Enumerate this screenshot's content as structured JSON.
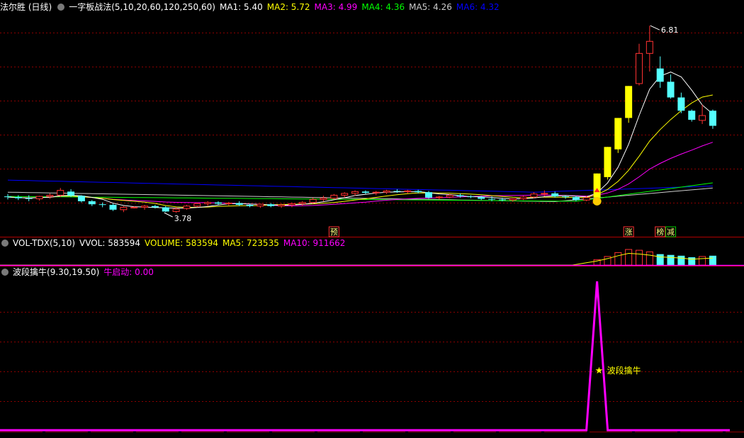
{
  "main": {
    "title": "法尔胜 (日线)",
    "indicator": "一字板战法(5,10,20,60,120,250,60)",
    "ma": [
      {
        "label": "MA1: 5.40",
        "color": "#ffffff"
      },
      {
        "label": "MA2: 5.72",
        "color": "#ffff00"
      },
      {
        "label": "MA3: 4.99",
        "color": "#ff00ff"
      },
      {
        "label": "MA4: 4.36",
        "color": "#00ff00"
      },
      {
        "label": "MA5: 4.26",
        "color": "#cccccc"
      },
      {
        "label": "MA6: 4.32",
        "color": "#0000ff"
      }
    ],
    "high_label": "6.81",
    "low_label": "3.78",
    "markers": [
      {
        "text": "预"
      },
      {
        "text": "涨"
      },
      {
        "text": "榜"
      },
      {
        "text": "减"
      }
    ]
  },
  "vol": {
    "title": "VOL-TDX(5,10)",
    "items": [
      {
        "label": "VVOL: 583594",
        "color": "#ffffff"
      },
      {
        "label": "VOLUME: 583594",
        "color": "#ffff00"
      },
      {
        "label": "MA5: 723535",
        "color": "#ffff00"
      },
      {
        "label": "MA10: 911662",
        "color": "#ff00ff"
      }
    ]
  },
  "ind": {
    "title": "波段擒牛",
    "params": "(9.30,19.50)",
    "value_label": "牛启动: 0.00",
    "signal_label": "波段擒牛"
  },
  "colors": {
    "up": "#ff3232",
    "down": "#54ffff",
    "limit": "#ffff00",
    "signal": "#ff00ff",
    "grid": "#8b0000"
  },
  "chart_data": {
    "type": "candlestick",
    "ohlc": [
      [
        3.98,
        4.02,
        3.93,
        3.97
      ],
      [
        3.97,
        4.0,
        3.92,
        3.95
      ],
      [
        3.95,
        4.0,
        3.9,
        3.94
      ],
      [
        3.94,
        3.99,
        3.91,
        3.98
      ],
      [
        3.98,
        4.03,
        3.94,
        4.0
      ],
      [
        4.0,
        4.12,
        3.97,
        4.08
      ],
      [
        4.06,
        4.1,
        3.97,
        3.99
      ],
      [
        3.99,
        4.0,
        3.88,
        3.9
      ],
      [
        3.9,
        3.92,
        3.82,
        3.85
      ],
      [
        3.85,
        3.88,
        3.8,
        3.84
      ],
      [
        3.84,
        3.86,
        3.74,
        3.76
      ],
      [
        3.76,
        3.82,
        3.72,
        3.8
      ],
      [
        3.8,
        3.82,
        3.78,
        3.8
      ],
      [
        3.8,
        3.84,
        3.76,
        3.82
      ],
      [
        3.82,
        3.84,
        3.78,
        3.8
      ],
      [
        3.8,
        3.82,
        3.72,
        3.73
      ],
      [
        3.73,
        3.8,
        3.71,
        3.77
      ],
      [
        3.78,
        3.84,
        3.76,
        3.82
      ],
      [
        3.82,
        3.88,
        3.8,
        3.86
      ],
      [
        3.86,
        3.9,
        3.82,
        3.88
      ],
      [
        3.88,
        3.9,
        3.84,
        3.86
      ],
      [
        3.86,
        3.89,
        3.83,
        3.87
      ],
      [
        3.87,
        3.9,
        3.82,
        3.84
      ],
      [
        3.84,
        3.86,
        3.8,
        3.82
      ],
      [
        3.82,
        3.86,
        3.79,
        3.85
      ],
      [
        3.85,
        3.87,
        3.8,
        3.82
      ],
      [
        3.82,
        3.86,
        3.79,
        3.84
      ],
      [
        3.84,
        3.88,
        3.8,
        3.86
      ],
      [
        3.86,
        3.9,
        3.82,
        3.88
      ],
      [
        3.88,
        3.96,
        3.86,
        3.93
      ],
      [
        3.93,
        3.99,
        3.9,
        3.95
      ],
      [
        3.95,
        4.02,
        3.93,
        4.0
      ],
      [
        4.0,
        4.05,
        3.96,
        4.03
      ],
      [
        4.03,
        4.08,
        3.99,
        4.06
      ],
      [
        4.06,
        4.08,
        4.02,
        4.04
      ],
      [
        4.04,
        4.07,
        4.0,
        4.05
      ],
      [
        4.05,
        4.09,
        4.02,
        4.07
      ],
      [
        4.07,
        4.1,
        4.04,
        4.06
      ],
      [
        4.06,
        4.09,
        4.03,
        4.07
      ],
      [
        4.07,
        4.09,
        4.03,
        4.05
      ],
      [
        4.05,
        4.07,
        3.94,
        3.96
      ],
      [
        3.96,
        3.99,
        3.93,
        3.97
      ],
      [
        3.97,
        4.02,
        3.95,
        4.0
      ],
      [
        4.0,
        4.03,
        3.96,
        3.98
      ],
      [
        3.98,
        4.0,
        3.95,
        3.97
      ],
      [
        3.97,
        3.99,
        3.92,
        3.94
      ],
      [
        3.94,
        3.98,
        3.9,
        3.93
      ],
      [
        3.93,
        3.96,
        3.9,
        3.92
      ],
      [
        3.92,
        3.95,
        3.89,
        3.94
      ],
      [
        3.94,
        3.99,
        3.92,
        3.97
      ],
      [
        3.97,
        4.05,
        3.95,
        4.02
      ],
      [
        4.02,
        4.08,
        3.98,
        4.03
      ],
      [
        4.03,
        4.06,
        3.96,
        3.98
      ],
      [
        3.98,
        4.0,
        3.94,
        3.97
      ],
      [
        3.97,
        3.99,
        3.9,
        3.92
      ],
      [
        3.92,
        3.99,
        3.9,
        3.96
      ],
      [
        3.96,
        4.36,
        3.95,
        4.36
      ],
      [
        4.3,
        4.8,
        4.26,
        4.8
      ],
      [
        4.76,
        5.28,
        4.7,
        5.28
      ],
      [
        5.28,
        5.81,
        5.2,
        5.81
      ],
      [
        5.85,
        6.51,
        5.82,
        6.35
      ],
      [
        6.35,
        6.81,
        6.05,
        6.55
      ],
      [
        6.1,
        6.3,
        5.78,
        5.88
      ],
      [
        5.88,
        6.0,
        5.6,
        5.62
      ],
      [
        5.62,
        5.7,
        5.36,
        5.4
      ],
      [
        5.4,
        5.42,
        5.22,
        5.25
      ],
      [
        5.24,
        5.5,
        5.18,
        5.32
      ],
      [
        5.4,
        5.42,
        5.1,
        5.15
      ]
    ],
    "limit_up_days": [
      56,
      57,
      58,
      59
    ],
    "volume_visible_last": 12,
    "indicator_peak": {
      "x": "day 56",
      "value": 1.0
    },
    "price_range": [
      3.5,
      7.0
    ],
    "grid": true
  }
}
